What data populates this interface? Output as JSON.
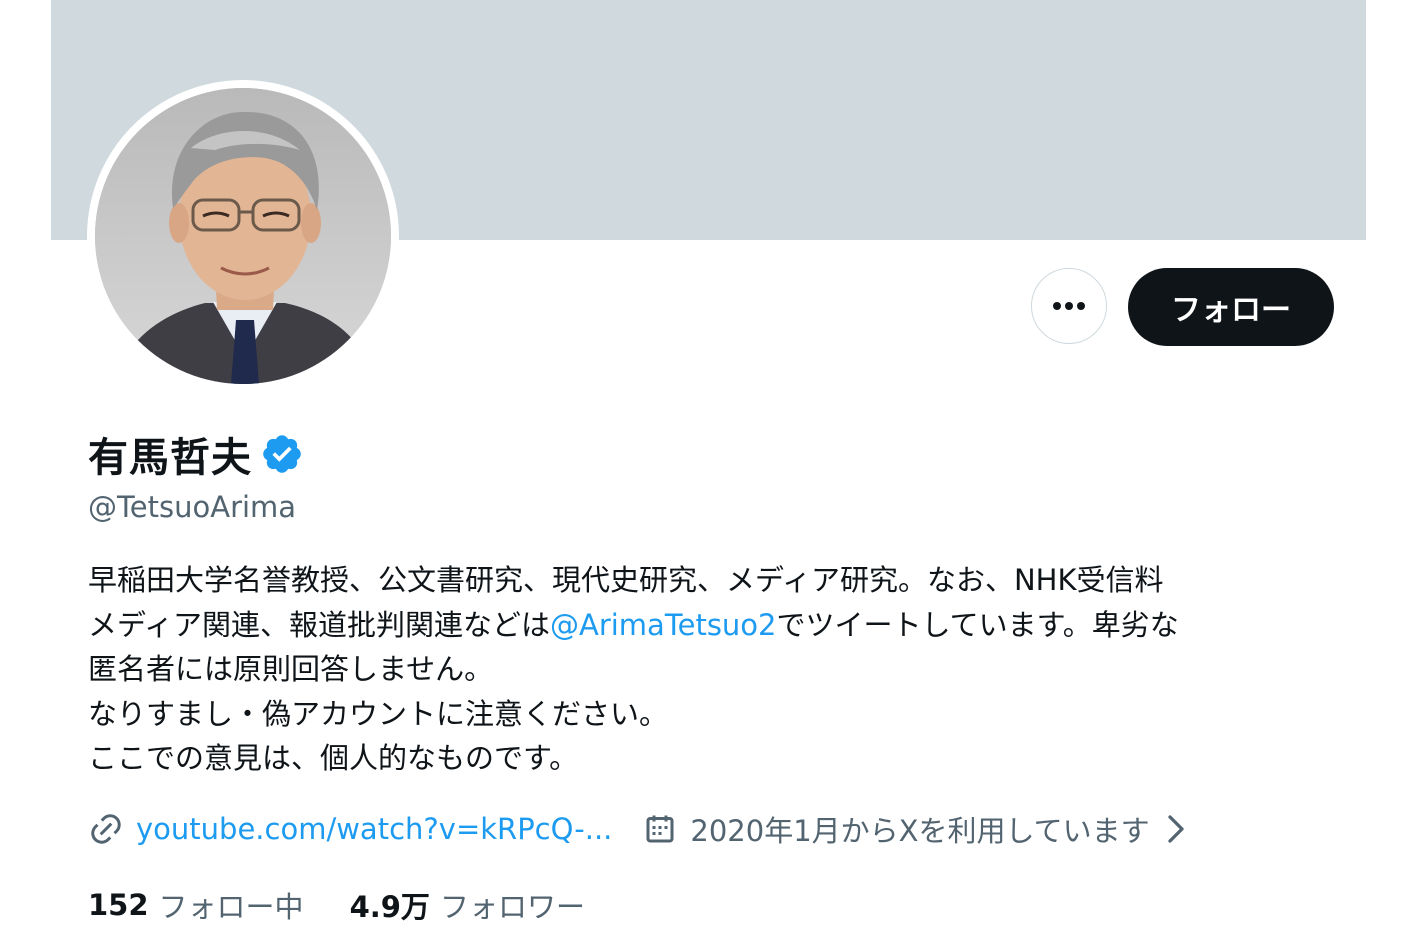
{
  "profile": {
    "display_name": "有馬哲夫",
    "handle": "@TetsuoArima",
    "verified_icon": "verified-badge-icon",
    "bio_line1": "早稲田大学名誉教授、公文書研究、現代史研究、メディア研究。なお、NHK受信料",
    "bio_line2_pre": "メディア関連、報道批判関連などは",
    "bio_line2_mention": "@ArimaTetsuo2",
    "bio_line2_post": "でツイートしています。卑劣な",
    "bio_line3": "匿名者には原則回答しません。",
    "bio_line4": "なりすまし・偽アカウントに注意ください。",
    "bio_line5": "ここでの意見は、個人的なものです。",
    "link": "youtube.com/watch?v=kRPcQ-...",
    "joined": "2020年1月からXを利用しています"
  },
  "actions": {
    "more_label": "•••",
    "follow_label": "フォロー"
  },
  "stats": {
    "following_count": "152",
    "following_label": "フォロー中",
    "followers_count": "4.9万",
    "followers_label": "フォロワー"
  },
  "colors": {
    "banner": "#cfd9de",
    "accent": "#1d9bf0",
    "muted": "#536471",
    "text": "#0f1419"
  }
}
